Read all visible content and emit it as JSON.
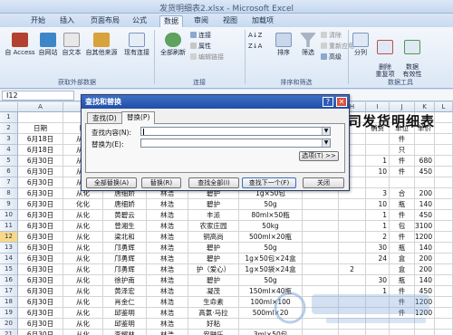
{
  "window": {
    "title": "发货明细表2.xlsx - Microsoft Excel"
  },
  "ribbon_tabs": [
    "开始",
    "插入",
    "页面布局",
    "公式",
    "数据",
    "审阅",
    "视图",
    "加载项"
  ],
  "active_tab": "数据",
  "ribbon": {
    "from_access": "自 Access",
    "from_web": "自网站",
    "from_text": "自文本",
    "other_sources": "自其他来源",
    "existing_connections": "现有连接",
    "refresh_all": "全部刷新",
    "connections": "连接",
    "properties": "属性",
    "edit_links": "编辑链接",
    "sort_az": "A↓Z",
    "sort_za": "Z↓A",
    "sort": "排序",
    "filter": "筛选",
    "clear": "清除",
    "reapply": "重新应用",
    "advanced": "高级",
    "text_to_columns": "分列",
    "remove_duplicates": "删除\n重复项",
    "data_validation": "数据\n有效性",
    "group_external": "获取外部数据",
    "group_connections": "连接",
    "group_sort_filter": "排序和筛选",
    "group_data_tools": "数据工具"
  },
  "formula_bar": {
    "name_box": "I12"
  },
  "sheet": {
    "title_text": "公司发货明细表",
    "columns": [
      "A",
      "B",
      "C",
      "D",
      "E",
      "F",
      "G",
      "H",
      "I",
      "J",
      "K",
      "L"
    ],
    "row_numbers": [
      "1",
      "2",
      "3",
      "4",
      "5",
      "6",
      "7",
      "8",
      "9",
      "10",
      "11",
      "12",
      "13",
      "14",
      "15",
      "16",
      "17",
      "18",
      "19",
      "20",
      "21"
    ],
    "header_row": {
      "date": "日期",
      "area": "区",
      "qty": "销货",
      "unit": "单位",
      "price": "单价"
    },
    "rows": [
      [
        "6月18日",
        "从化",
        "",
        "",
        "",
        "",
        "",
        "",
        "",
        "件",
        ""
      ],
      [
        "6月18日",
        "从化",
        "",
        "",
        "",
        "",
        "",
        "",
        "",
        "只",
        ""
      ],
      [
        "6月30日",
        "从化",
        "",
        "",
        "",
        "",
        "",
        "",
        "1",
        "件",
        "680"
      ],
      [
        "6月30日",
        "从化",
        "",
        "",
        "",
        "",
        "",
        "",
        "10",
        "件",
        "450"
      ],
      [
        "6月30日",
        "从化",
        "",
        "",
        "",
        "",
        "",
        "",
        "",
        "",
        ""
      ],
      [
        "6月30日",
        "从化",
        "唐细娇",
        "林浩",
        "碧护",
        "1g×50包",
        "",
        "",
        "3",
        "合",
        "200"
      ],
      [
        "6月30日",
        "化化",
        "唐细娇",
        "林浩",
        "碧护",
        "50g",
        "",
        "",
        "10",
        "瓶",
        "140"
      ],
      [
        "6月30日",
        "从化",
        "黄碧云",
        "林浩",
        "丰派",
        "80ml×50瓶",
        "",
        "",
        "1",
        "件",
        "450"
      ],
      [
        "6月30日",
        "从化",
        "曾湘生",
        "林浩",
        "农家庄园",
        "50kg",
        "",
        "",
        "1",
        "包",
        "3100"
      ],
      [
        "6月30日",
        "从化",
        "梁北和",
        "林浩",
        "铜高尚",
        "500ml×20瓶",
        "",
        "",
        "2",
        "件",
        "1200"
      ],
      [
        "6月30日",
        "从化",
        "邝勇辉",
        "林浩",
        "碧护",
        "50g",
        "",
        "",
        "30",
        "瓶",
        "140"
      ],
      [
        "6月30日",
        "从化",
        "邝勇辉",
        "林浩",
        "碧护",
        "1g×50包×24盒",
        "",
        "",
        "24",
        "盒",
        "200"
      ],
      [
        "6月30日",
        "从化",
        "邝勇辉",
        "林浩",
        "护（爱心）",
        "1g×50袋×24盒",
        "",
        "2",
        "",
        "盒",
        "200"
      ],
      [
        "6月30日",
        "从化",
        "徐护南",
        "林浩",
        "碧护",
        "50g",
        "",
        "",
        "30",
        "瓶",
        "140"
      ],
      [
        "6月30日",
        "从化",
        "黄泽宏",
        "林浩",
        "凝茂",
        "150ml×40瓶",
        "",
        "",
        "1",
        "件",
        "450"
      ],
      [
        "6月30日",
        "从化",
        "肖金仁",
        "林浩",
        "生命素",
        "100ml×100",
        "",
        "",
        "",
        "件",
        "1200"
      ],
      [
        "6月30日",
        "从化",
        "邱鉴明",
        "林浩",
        "高氯·马拉",
        "500ml×20",
        "",
        "",
        "",
        "件",
        "1200"
      ],
      [
        "6月30日",
        "从化",
        "邱鉴明",
        "林浩",
        "好粘",
        "",
        "",
        "",
        "",
        "",
        ""
      ],
      [
        "6月30日",
        "从化",
        "李耀林",
        "林浩",
        "安融乐",
        "3ml×50包",
        "",
        "",
        "",
        "",
        ""
      ]
    ]
  },
  "dialog": {
    "title": "查找和替换",
    "help": "?",
    "close": "✕",
    "tab_find": "查找(D)",
    "tab_replace": "替换(P)",
    "find_label": "查找内容(N):",
    "replace_label": "替换为(E):",
    "find_value": "",
    "replace_value": "",
    "options_button": "选项(T) >>",
    "replace_all_button": "全部替换(A)",
    "replace_button": "替换(R)",
    "find_all_button": "查找全部(I)",
    "find_next_button": "查找下一个(F)",
    "close_button": "关闭"
  },
  "colors": {
    "title_bar": "#1f4ea8",
    "selected_row": "#f9d889",
    "ribbon_bg": "#dbe7f5"
  }
}
